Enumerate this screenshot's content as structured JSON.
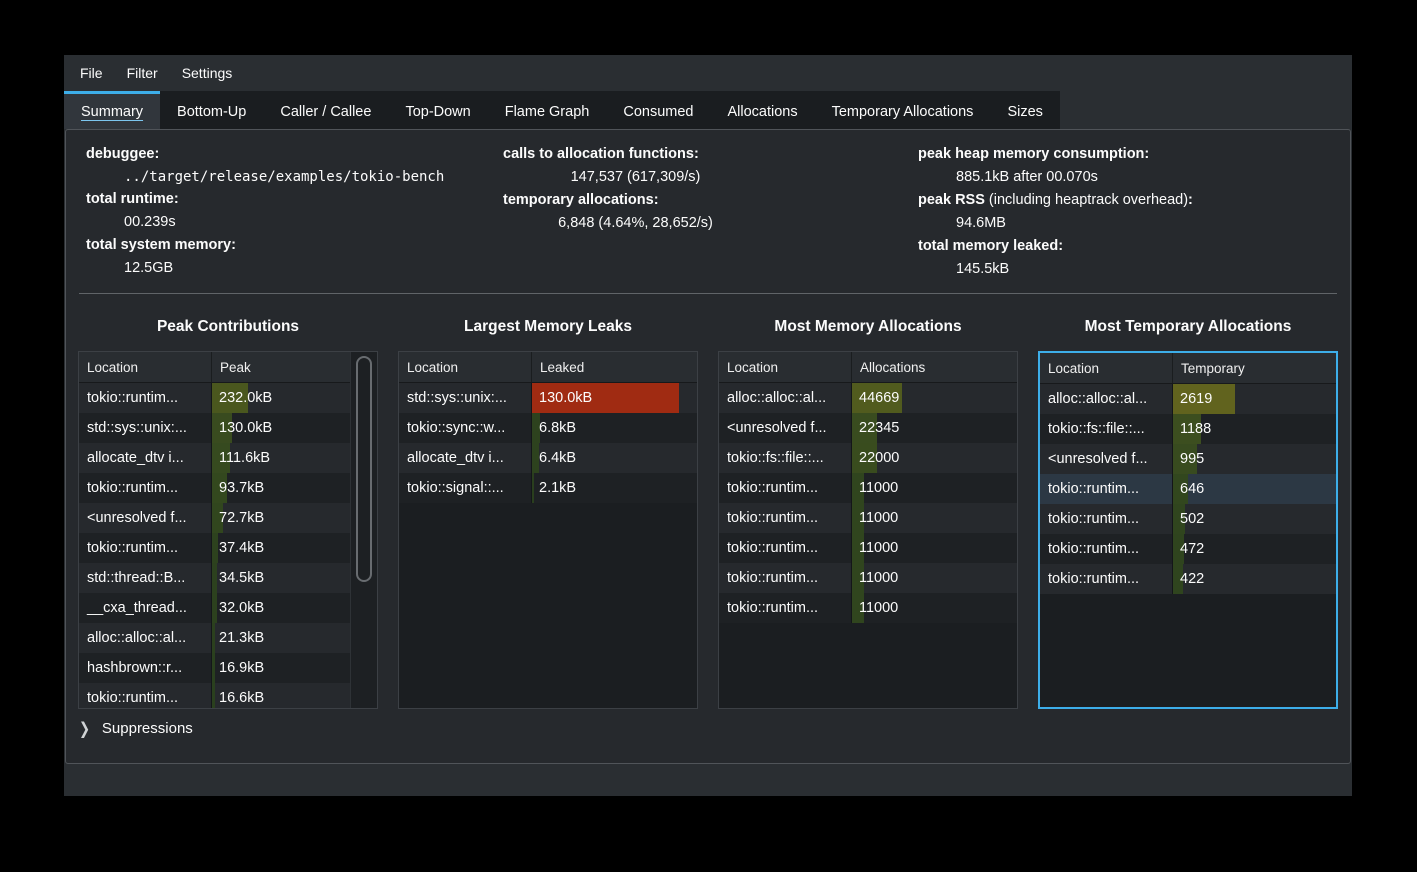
{
  "app": "heaptrack",
  "colors": {
    "accent": "#3daee9",
    "window_bg": "#2a2e32",
    "table_bg": "#1b1e21",
    "leak_bar_red": "#9e2b13",
    "cost_bar_green": "#4a5826"
  },
  "menu": {
    "items": [
      {
        "label": "File"
      },
      {
        "label": "Filter"
      },
      {
        "label": "Settings"
      }
    ]
  },
  "tabs": {
    "selected": "Summary",
    "items": [
      {
        "label": "Summary",
        "selected": true
      },
      {
        "label": "Bottom-Up",
        "selected": false
      },
      {
        "label": "Caller / Callee",
        "selected": false
      },
      {
        "label": "Top-Down",
        "selected": false
      },
      {
        "label": "Flame Graph",
        "selected": false
      },
      {
        "label": "Consumed",
        "selected": false
      },
      {
        "label": "Allocations",
        "selected": false
      },
      {
        "label": "Temporary Allocations",
        "selected": false
      },
      {
        "label": "Sizes",
        "selected": false
      }
    ]
  },
  "summary": {
    "columns": [
      {
        "entries": [
          {
            "label": "debuggee",
            "value": "../target/release/examples/tokio-bench",
            "mono": true
          },
          {
            "label": "total runtime",
            "value": "00.239s"
          },
          {
            "label": "total system memory",
            "value": "12.5GB"
          }
        ]
      },
      {
        "entries": [
          {
            "label": "calls to allocation functions",
            "value": "147,537 (617,309/s)"
          },
          {
            "label": "temporary allocations",
            "value": "6,848 (4.64%, 28,652/s)"
          }
        ]
      },
      {
        "entries": [
          {
            "label": "peak heap memory consumption",
            "value": "885.1kB after 00.070s"
          },
          {
            "label": "peak RSS",
            "suffix": " (including heaptrack overhead)",
            "value": "94.6MB"
          },
          {
            "label": "total memory leaked",
            "value": "145.5kB"
          }
        ]
      }
    ]
  },
  "panels": [
    {
      "title": "Peak Contributions",
      "location_header": "Location",
      "value_header": "Peak",
      "total": 885.1,
      "scrollbar": true,
      "focused": false,
      "rows": [
        {
          "location": "tokio::runtim...",
          "value": 232.0,
          "display": "232.0kB"
        },
        {
          "location": "std::sys::unix:...",
          "value": 130.0,
          "display": "130.0kB"
        },
        {
          "location": "allocate_dtv i...",
          "value": 111.6,
          "display": "111.6kB"
        },
        {
          "location": "tokio::runtim...",
          "value": 93.7,
          "display": "93.7kB"
        },
        {
          "location": "<unresolved f...",
          "value": 72.7,
          "display": "72.7kB"
        },
        {
          "location": "tokio::runtim...",
          "value": 37.4,
          "display": "37.4kB"
        },
        {
          "location": "std::thread::B...",
          "value": 34.5,
          "display": "34.5kB"
        },
        {
          "location": "__cxa_thread...",
          "value": 32.0,
          "display": "32.0kB"
        },
        {
          "location": "alloc::alloc::al...",
          "value": 21.3,
          "display": "21.3kB"
        },
        {
          "location": "hashbrown::r...",
          "value": 16.9,
          "display": "16.9kB"
        },
        {
          "location": "tokio::runtim...",
          "value": 16.6,
          "display": "16.6kB"
        }
      ]
    },
    {
      "title": "Largest Memory Leaks",
      "location_header": "Location",
      "value_header": "Leaked",
      "total": 145.5,
      "scrollbar": false,
      "focused": false,
      "rows": [
        {
          "location": "std::sys::unix:...",
          "value": 130.0,
          "display": "130.0kB"
        },
        {
          "location": "tokio::sync::w...",
          "value": 6.8,
          "display": "6.8kB"
        },
        {
          "location": "allocate_dtv i...",
          "value": 6.4,
          "display": "6.4kB"
        },
        {
          "location": "tokio::signal::...",
          "value": 2.1,
          "display": "2.1kB"
        }
      ]
    },
    {
      "title": "Most Memory Allocations",
      "location_header": "Location",
      "value_header": "Allocations",
      "total": 147537,
      "scrollbar": false,
      "focused": false,
      "rows": [
        {
          "location": "alloc::alloc::al...",
          "value": 44669,
          "display": "44669"
        },
        {
          "location": "<unresolved f...",
          "value": 22345,
          "display": "22345"
        },
        {
          "location": "tokio::fs::file::...",
          "value": 22000,
          "display": "22000"
        },
        {
          "location": "tokio::runtim...",
          "value": 11000,
          "display": "11000"
        },
        {
          "location": "tokio::runtim...",
          "value": 11000,
          "display": "11000"
        },
        {
          "location": "tokio::runtim...",
          "value": 11000,
          "display": "11000"
        },
        {
          "location": "tokio::runtim...",
          "value": 11000,
          "display": "11000"
        },
        {
          "location": "tokio::runtim...",
          "value": 11000,
          "display": "11000"
        }
      ]
    },
    {
      "title": "Most Temporary Allocations",
      "location_header": "Location",
      "value_header": "Temporary",
      "total": 6848,
      "scrollbar": false,
      "focused": true,
      "rows": [
        {
          "location": "alloc::alloc::al...",
          "value": 2619,
          "display": "2619"
        },
        {
          "location": "tokio::fs::file::...",
          "value": 1188,
          "display": "1188"
        },
        {
          "location": "<unresolved f...",
          "value": 995,
          "display": "995"
        },
        {
          "location": "tokio::runtim...",
          "value": 646,
          "display": "646",
          "highlight": true
        },
        {
          "location": "tokio::runtim...",
          "value": 502,
          "display": "502"
        },
        {
          "location": "tokio::runtim...",
          "value": 472,
          "display": "472"
        },
        {
          "location": "tokio::runtim...",
          "value": 422,
          "display": "422"
        }
      ]
    }
  ],
  "suppressions": {
    "label": "Suppressions",
    "chevron": "❯"
  }
}
